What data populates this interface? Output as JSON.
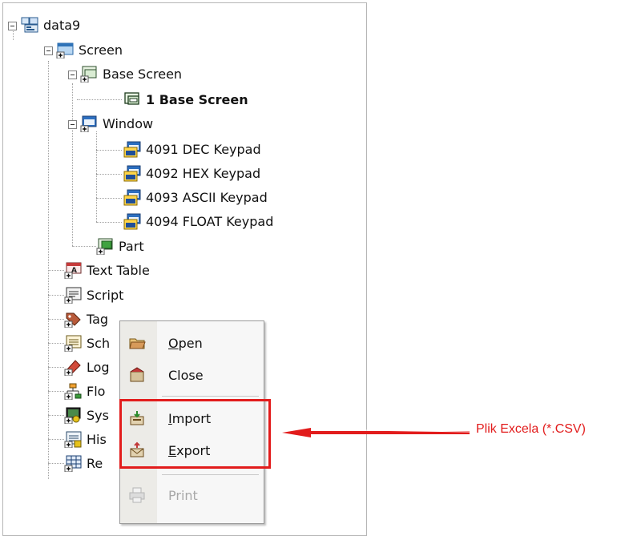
{
  "tree": {
    "root": {
      "label": "data9",
      "icon": "project-icon"
    },
    "screen": {
      "label": "Screen",
      "icon": "screen-folder-icon"
    },
    "base_screen": {
      "label": "Base Screen",
      "icon": "base-screen-folder-icon"
    },
    "base_screen_1": {
      "label": "1 Base Screen",
      "icon": "base-screen-icon"
    },
    "window": {
      "label": "Window",
      "icon": "window-folder-icon"
    },
    "keypads": [
      {
        "label": "4091 DEC Keypad",
        "icon": "window-icon"
      },
      {
        "label": "4092 HEX Keypad",
        "icon": "window-icon"
      },
      {
        "label": "4093 ASCII Keypad",
        "icon": "window-icon"
      },
      {
        "label": "4094 FLOAT Keypad",
        "icon": "window-icon"
      }
    ],
    "part": {
      "label": "Part",
      "icon": "part-icon"
    },
    "text_table": {
      "label": "Text Table",
      "icon": "text-table-icon"
    },
    "script": {
      "label": "Script",
      "icon": "script-icon"
    },
    "tag": {
      "label": "Tag",
      "icon": "tag-icon"
    },
    "partial_items": [
      {
        "label": "Sch",
        "icon": "schedule-icon"
      },
      {
        "label": "Log",
        "icon": "logging-icon"
      },
      {
        "label": "Flo",
        "icon": "flow-icon"
      },
      {
        "label": "Sys",
        "icon": "system-icon"
      },
      {
        "label": "His",
        "icon": "history-icon"
      },
      {
        "label": "Re",
        "icon": "recipe-icon"
      }
    ]
  },
  "context_menu": {
    "items": [
      {
        "label": "Open",
        "accel": "O",
        "rest": "pen",
        "icon": "open-folder-icon",
        "enabled": true
      },
      {
        "label": "Close",
        "accel": "",
        "rest": "Close",
        "icon": "close-box-icon",
        "enabled": true
      },
      {
        "label": "Import",
        "accel": "I",
        "rest": "mport",
        "icon": "import-icon",
        "enabled": true
      },
      {
        "label": "Export",
        "accel": "E",
        "rest": "xport",
        "icon": "export-icon",
        "enabled": true
      },
      {
        "label": "Print",
        "accel": "",
        "rest": "Print",
        "icon": "printer-icon",
        "enabled": false
      }
    ]
  },
  "annotation": {
    "text": "Plik Excela (*.CSV)",
    "color": "#e21c1c"
  }
}
